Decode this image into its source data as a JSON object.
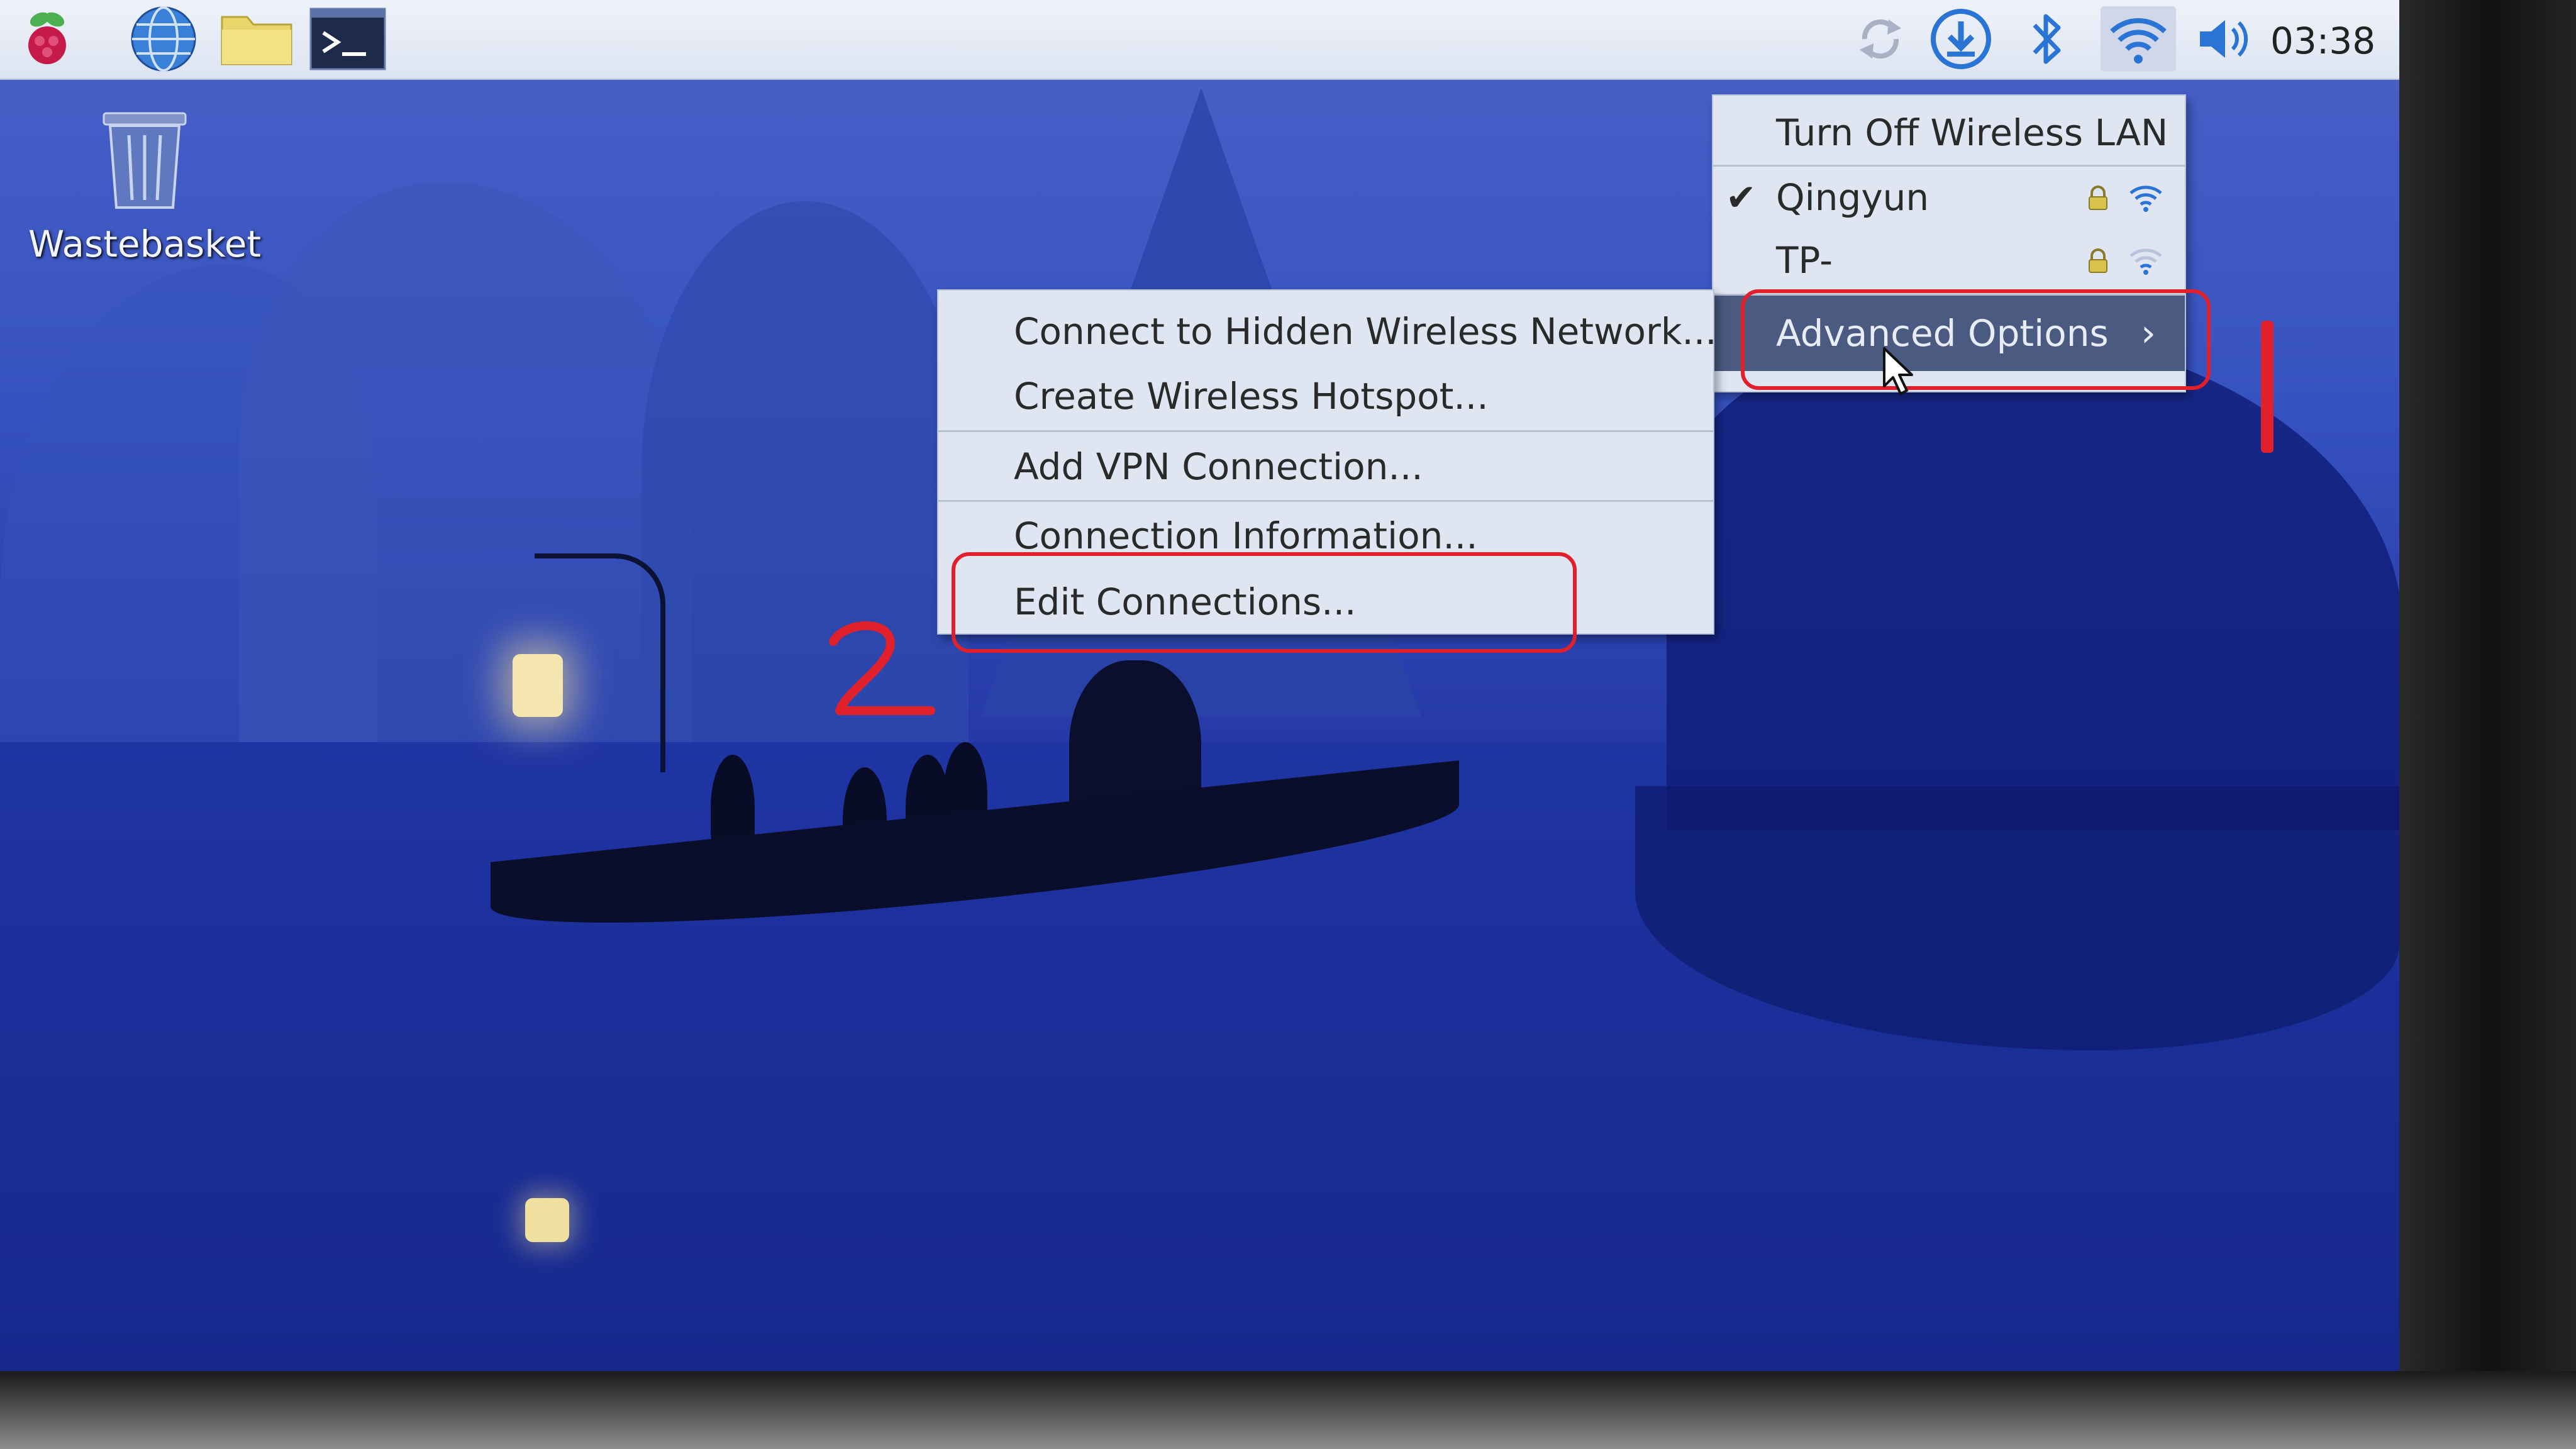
{
  "taskbar": {
    "clock": "03:38",
    "icons": [
      "raspberry-menu-icon",
      "web-browser-icon",
      "file-manager-icon",
      "terminal-icon",
      "sync-icon",
      "download-icon",
      "bluetooth-icon",
      "wifi-icon",
      "volume-icon"
    ]
  },
  "desktop": {
    "wastebasket_label": "Wastebasket"
  },
  "wifi_menu": {
    "turn_off": "Turn Off Wireless LAN",
    "networks": [
      {
        "name": "Qingyun",
        "connected": true,
        "secured": true
      },
      {
        "name": "TP-",
        "connected": false,
        "secured": true
      }
    ],
    "advanced": "Advanced Options"
  },
  "advanced_menu": {
    "items": [
      "Connect to Hidden Wireless Network...",
      "Create Wireless Hotspot...",
      "Add VPN Connection...",
      "Connection Information...",
      "Edit Connections..."
    ]
  },
  "annotations": {
    "step1": "1",
    "step2": "2",
    "color": "#e0202a"
  },
  "colors": {
    "menu_bg": "#dfe6f2",
    "menu_highlight": "#4a5a80",
    "taskbar_bg": "#eef2fa"
  }
}
